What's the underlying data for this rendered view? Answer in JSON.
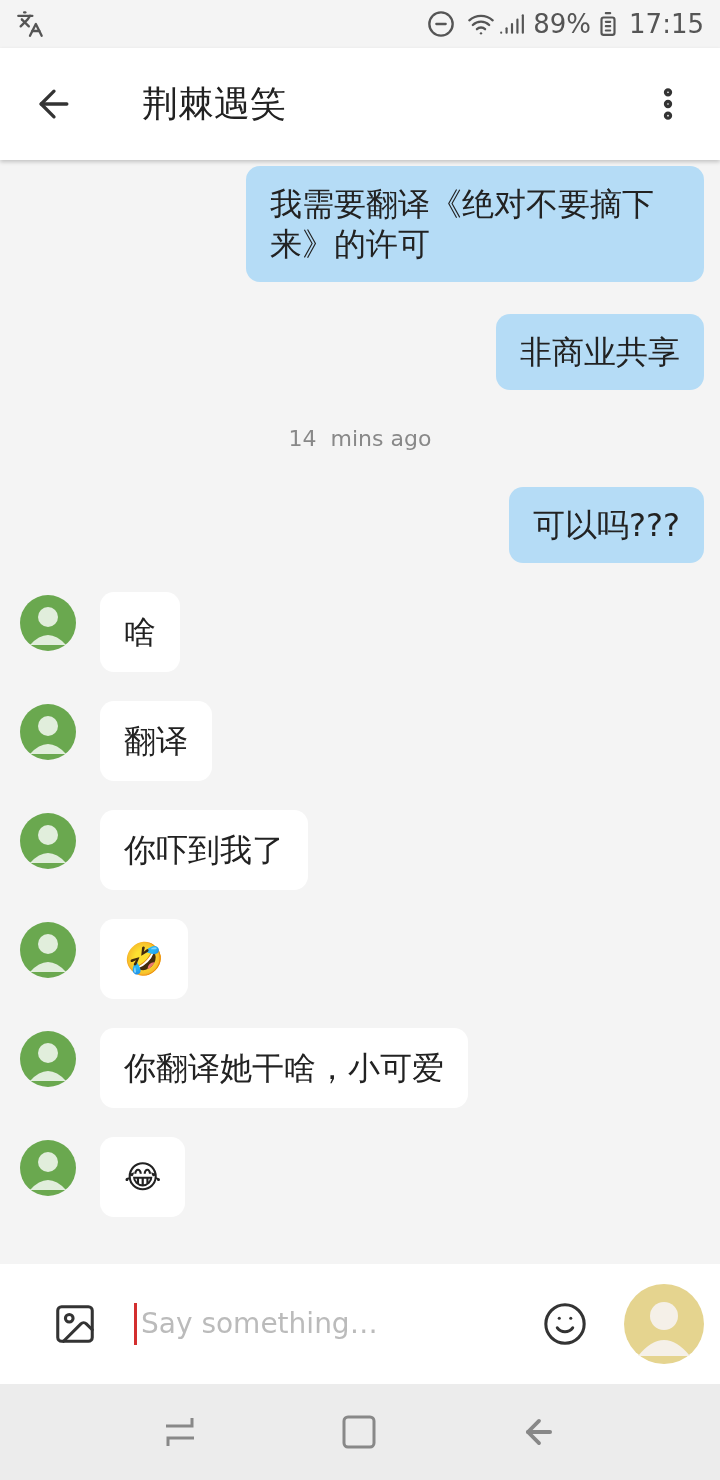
{
  "status_bar": {
    "battery": "89%",
    "time": "17:15"
  },
  "header": {
    "title": "荆棘遇笑"
  },
  "messages": [
    {
      "kind": "outgoing",
      "text": "我需要翻译《绝对不要摘下来》的许可"
    },
    {
      "kind": "outgoing",
      "text": "非商业共享"
    },
    {
      "kind": "timestamp",
      "text": "14  mins ago"
    },
    {
      "kind": "outgoing",
      "text": "可以吗???"
    },
    {
      "kind": "incoming",
      "text": "啥"
    },
    {
      "kind": "incoming",
      "text": "翻译"
    },
    {
      "kind": "incoming",
      "text": "你吓到我了"
    },
    {
      "kind": "incoming",
      "text": "🤣"
    },
    {
      "kind": "incoming",
      "text": "你翻译她干啥，小可爱"
    },
    {
      "kind": "incoming",
      "text": "😂"
    }
  ],
  "composer": {
    "placeholder": "Say something…"
  }
}
